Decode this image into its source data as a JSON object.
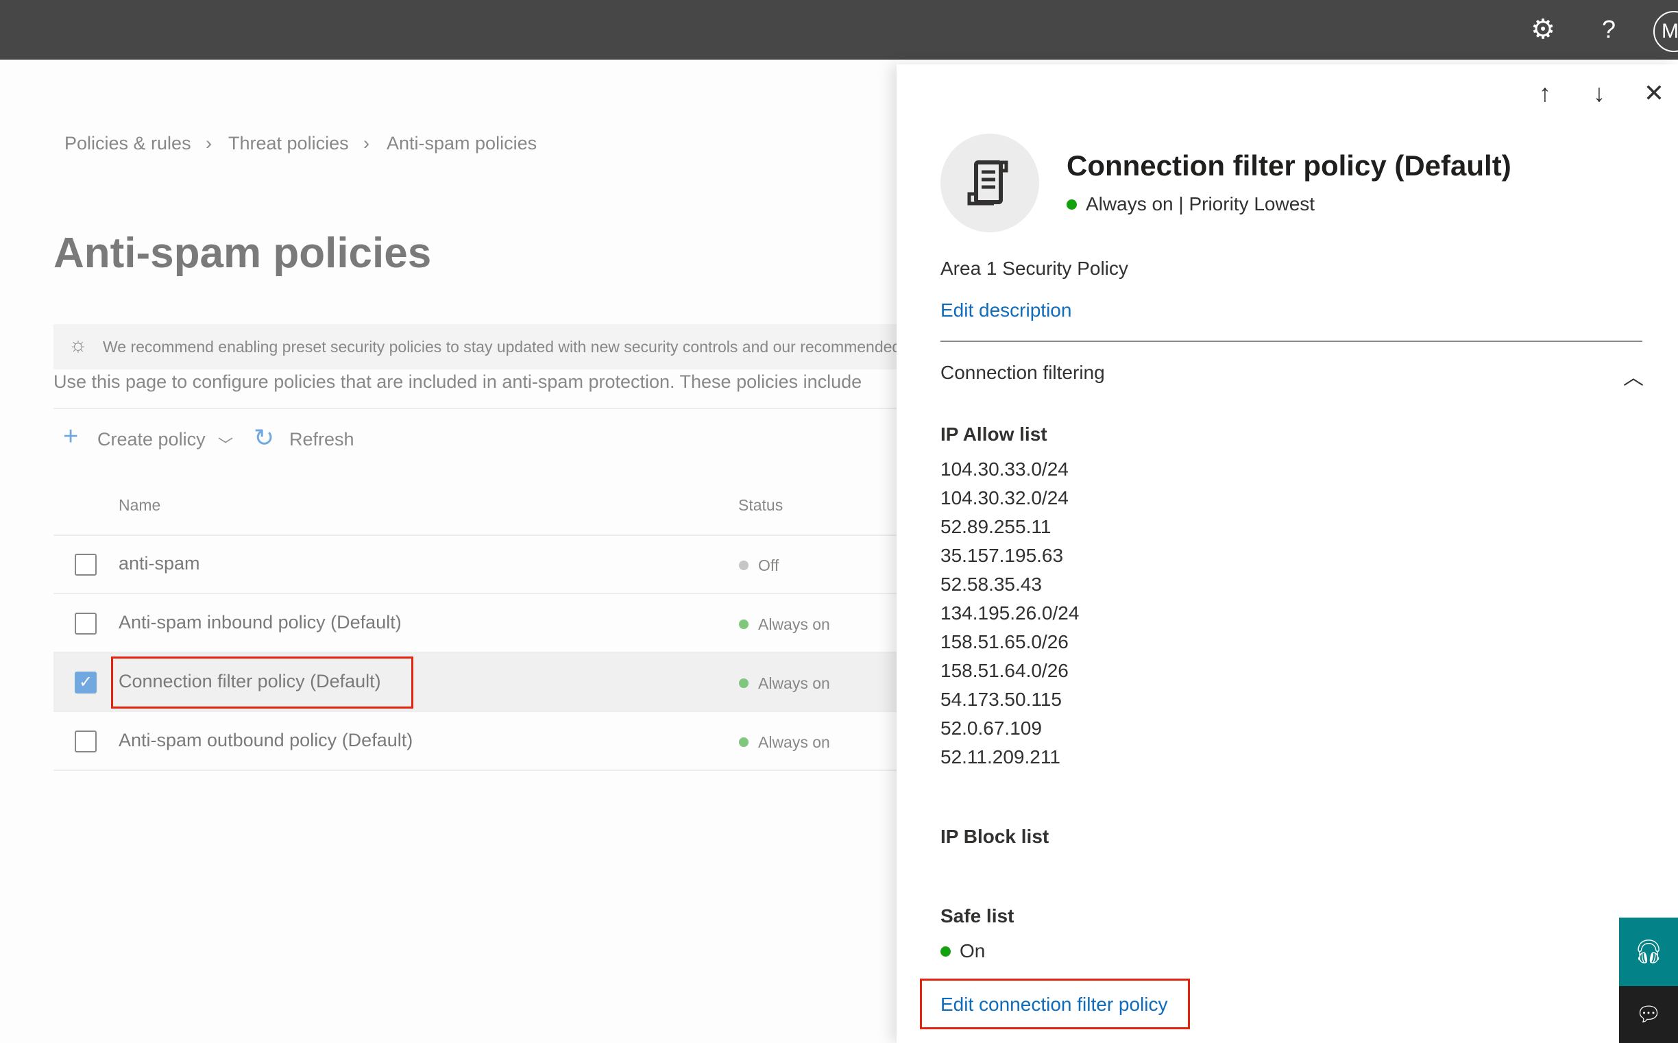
{
  "topbar": {
    "icons": [
      "gear-icon",
      "help-icon"
    ],
    "help_glyph": "?",
    "avatar_initial": "M"
  },
  "breadcrumb": [
    "Policies & rules",
    "Threat policies",
    "Anti-spam policies"
  ],
  "page_title": "Anti-spam policies",
  "recommendation": "We recommend enabling preset security policies to stay updated with new security controls and our recommended settings",
  "description": "Use this page to configure policies that are included in anti-spam protection. These policies include",
  "toolbar": {
    "create": "Create policy",
    "refresh": "Refresh"
  },
  "table": {
    "headers": [
      "Name",
      "Status"
    ],
    "rows": [
      {
        "name": "anti-spam",
        "status": "Off",
        "checked": false
      },
      {
        "name": "Anti-spam inbound policy (Default)",
        "status": "Always on",
        "checked": false
      },
      {
        "name": "Connection filter policy (Default)",
        "status": "Always on",
        "checked": true
      },
      {
        "name": "Anti-spam outbound policy (Default)",
        "status": "Always on",
        "checked": false
      }
    ]
  },
  "colors": {
    "on": "#13a10e",
    "on_muted": "#7fc77c",
    "off": "#c8c6c4",
    "link": "#0f6cbd",
    "highlight": "#e3230e",
    "teal": "#038387"
  },
  "panel": {
    "title": "Connection filter policy (Default)",
    "status": "Always on | Priority Lowest",
    "description": "Area 1 Security Policy",
    "edit_description": "Edit description",
    "section": "Connection filtering",
    "ip_allow_label": "IP Allow list",
    "ip_allow": [
      "104.30.33.0/24",
      "104.30.32.0/24",
      "52.89.255.11",
      "35.157.195.63",
      "52.58.35.43",
      "134.195.26.0/24",
      "158.51.65.0/26",
      "158.51.64.0/26",
      "54.173.50.115",
      "52.0.67.109",
      "52.11.209.211"
    ],
    "ip_block_label": "IP Block list",
    "safe_list_label": "Safe list",
    "safe_list_value": "On",
    "edit_link": "Edit connection filter policy"
  }
}
